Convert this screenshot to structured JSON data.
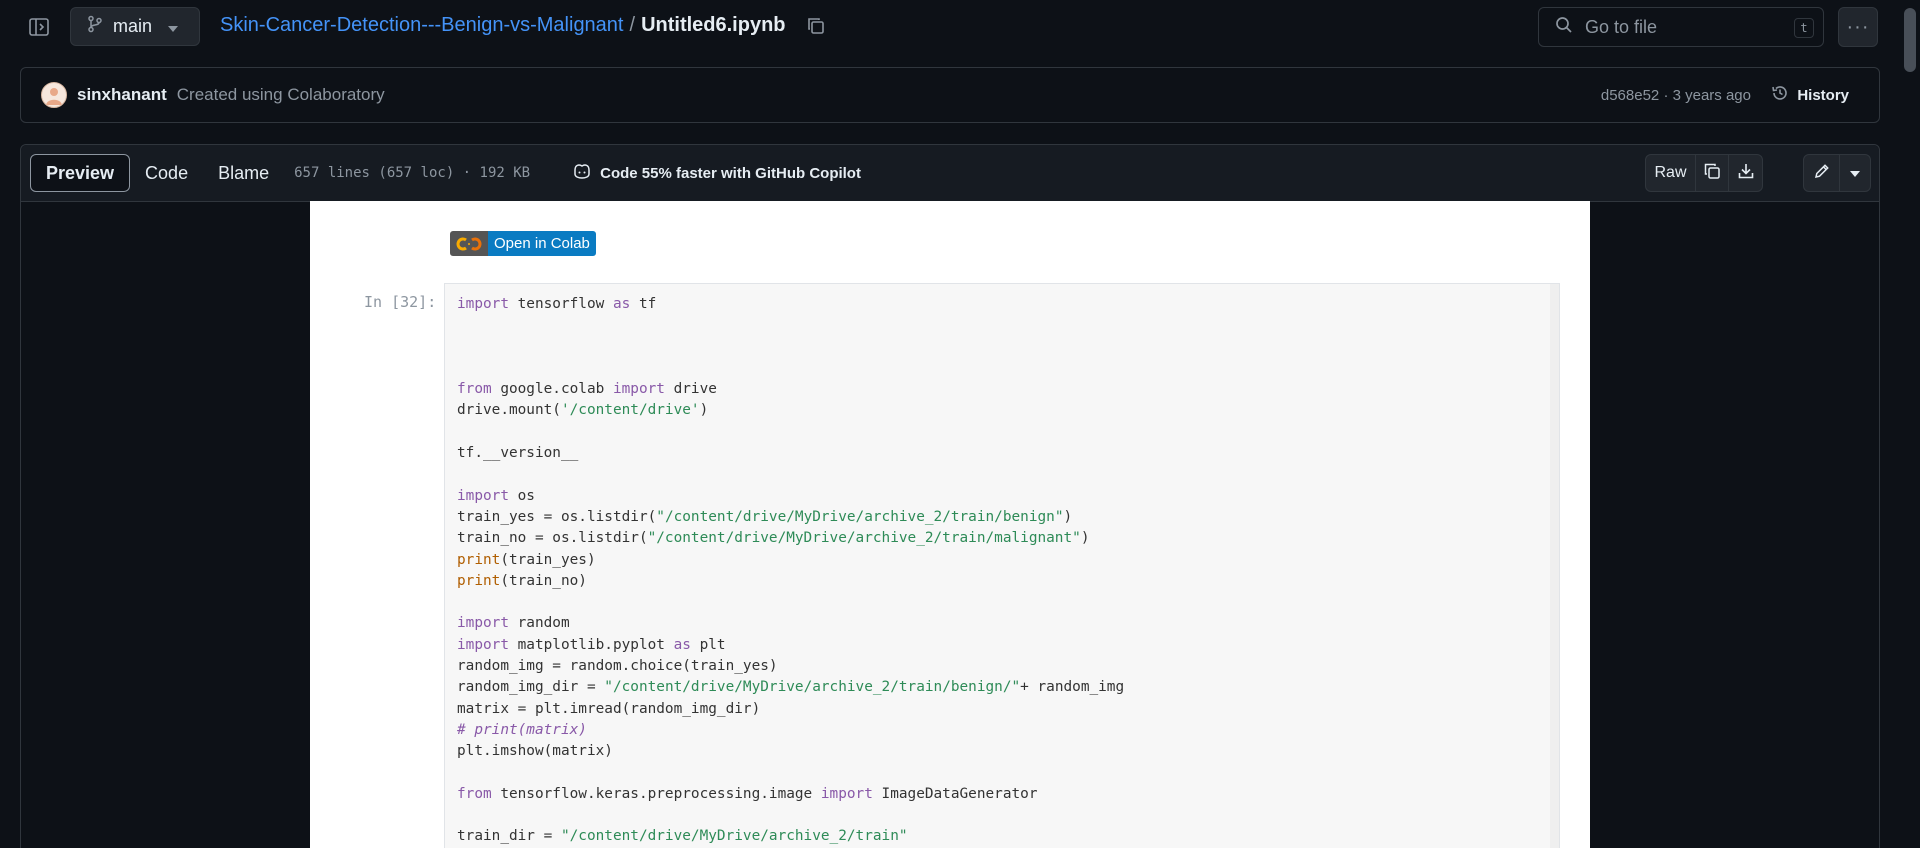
{
  "topbar": {
    "branch": "main",
    "repo_name": "Skin-Cancer-Detection---Benign-vs-Malignant",
    "separator": "/",
    "file_name": "Untitled6.ipynb",
    "search_placeholder": "Go to file",
    "search_shortcut": "t",
    "more_label": "···"
  },
  "commit": {
    "author": "sinxhanant",
    "message": "Created using Colaboratory",
    "meta": "d568e52 · 3 years ago",
    "history_label": "History"
  },
  "file_header": {
    "tabs": [
      "Preview",
      "Code",
      "Blame"
    ],
    "active_tab": "Preview",
    "info": "657 lines (657 loc) · 192 KB",
    "copilot": "Code 55% faster with GitHub Copilot",
    "raw_label": "Raw"
  },
  "notebook": {
    "colab_badge": "Open in Colab",
    "prompt": "In [32]:"
  },
  "colors": {
    "page_bg": "#0d1117",
    "link": "#4493f8",
    "border": "#30363d",
    "muted": "#8d96a0",
    "keyword": "#8959a8",
    "string": "#2e8b57",
    "builtin": "#b05e00"
  }
}
